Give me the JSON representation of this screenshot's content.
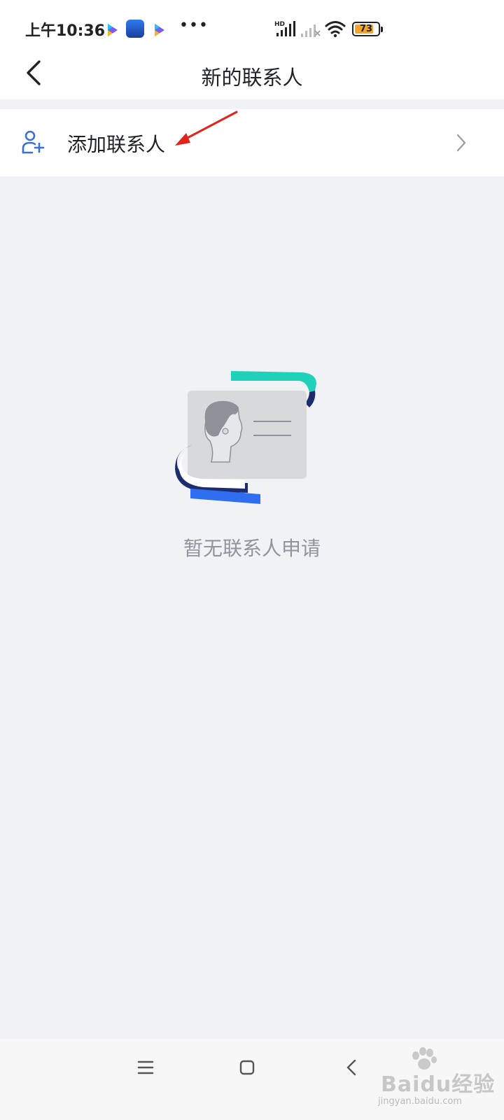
{
  "status_bar": {
    "time": "上午10:36",
    "more": "•••",
    "signal_label": "HD",
    "battery_level": "73",
    "icons": [
      "video-play-icon",
      "app-notification-icon",
      "video-play-icon",
      "more-icon",
      "signal-hd-icon",
      "signal-icon",
      "wifi-icon",
      "battery-icon"
    ]
  },
  "header": {
    "title": "新的联系人",
    "back_icon": "back-arrow-icon"
  },
  "add_contact_row": {
    "label": "添加联系人",
    "icon": "add-person-icon",
    "chevron": "chevron-right-icon"
  },
  "empty_state": {
    "message": "暂无联系人申请",
    "illustration": "contact-card-illustration"
  },
  "nav_bar": {
    "icons": [
      "menu-icon",
      "home-icon",
      "back-icon"
    ]
  },
  "watermark": {
    "text": "Baidu经验",
    "url": "jingyan.baidu.com"
  },
  "colors": {
    "accent": "#3b6fd6",
    "annotation_arrow": "#e0241e",
    "background": "#f1f2f5",
    "battery": "#f4a52a",
    "teal": "#1fd1b9",
    "navy": "#1d2c6e",
    "blue": "#2f6ef0"
  }
}
